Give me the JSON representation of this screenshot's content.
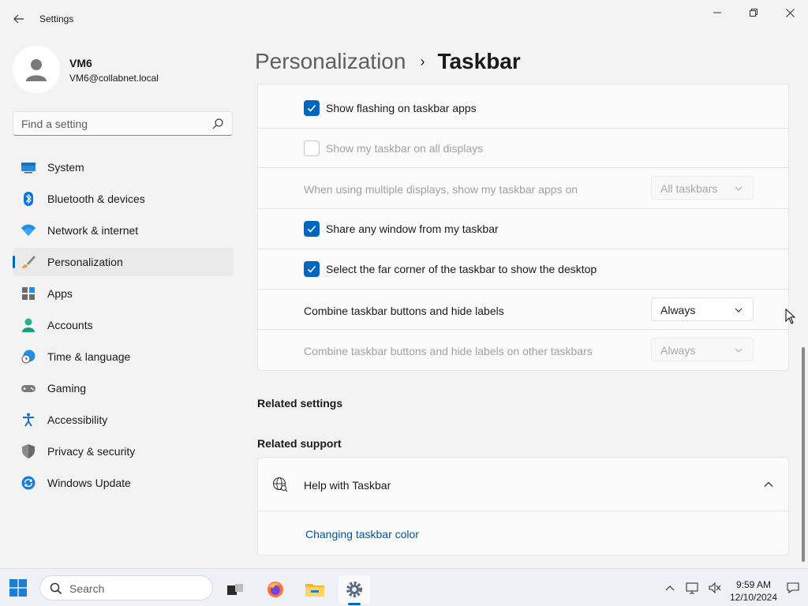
{
  "window": {
    "app_title": "Settings"
  },
  "profile": {
    "name": "VM6",
    "email": "VM6@collabnet.local"
  },
  "search": {
    "placeholder": "Find a setting"
  },
  "sidebar": {
    "items": [
      {
        "label": "System",
        "icon": "system-icon"
      },
      {
        "label": "Bluetooth & devices",
        "icon": "bluetooth-icon"
      },
      {
        "label": "Network & internet",
        "icon": "wifi-icon"
      },
      {
        "label": "Personalization",
        "icon": "brush-icon",
        "active": true
      },
      {
        "label": "Apps",
        "icon": "apps-icon"
      },
      {
        "label": "Accounts",
        "icon": "accounts-icon"
      },
      {
        "label": "Time & language",
        "icon": "clock-globe-icon"
      },
      {
        "label": "Gaming",
        "icon": "gamepad-icon"
      },
      {
        "label": "Accessibility",
        "icon": "accessibility-icon"
      },
      {
        "label": "Privacy & security",
        "icon": "shield-icon"
      },
      {
        "label": "Windows Update",
        "icon": "update-icon"
      }
    ]
  },
  "breadcrumb": {
    "parent": "Personalization",
    "separator": "›",
    "current": "Taskbar"
  },
  "settings": {
    "show_flashing": {
      "label": "Show flashing on taskbar apps",
      "checked": true,
      "enabled": true
    },
    "show_all_displays": {
      "label": "Show my taskbar on all displays",
      "checked": false,
      "enabled": false
    },
    "multi_display_apps": {
      "label": "When using multiple displays, show my taskbar apps on",
      "value": "All taskbars",
      "enabled": false
    },
    "share_window": {
      "label": "Share any window from my taskbar",
      "checked": true,
      "enabled": true
    },
    "far_corner": {
      "label": "Select the far corner of the taskbar to show the desktop",
      "checked": true,
      "enabled": true
    },
    "combine_buttons": {
      "label": "Combine taskbar buttons and hide labels",
      "value": "Always",
      "enabled": true
    },
    "combine_other": {
      "label": "Combine taskbar buttons and hide labels on other taskbars",
      "value": "Always",
      "enabled": false
    }
  },
  "related_settings": {
    "title": "Related settings"
  },
  "related_support": {
    "title": "Related support",
    "help_title": "Help with Taskbar",
    "link": "Changing taskbar color"
  },
  "taskbar": {
    "search_label": "Search",
    "time": "9:59 AM",
    "date": "12/10/2024"
  },
  "colors": {
    "accent": "#0067c0",
    "link": "#0055aa"
  }
}
